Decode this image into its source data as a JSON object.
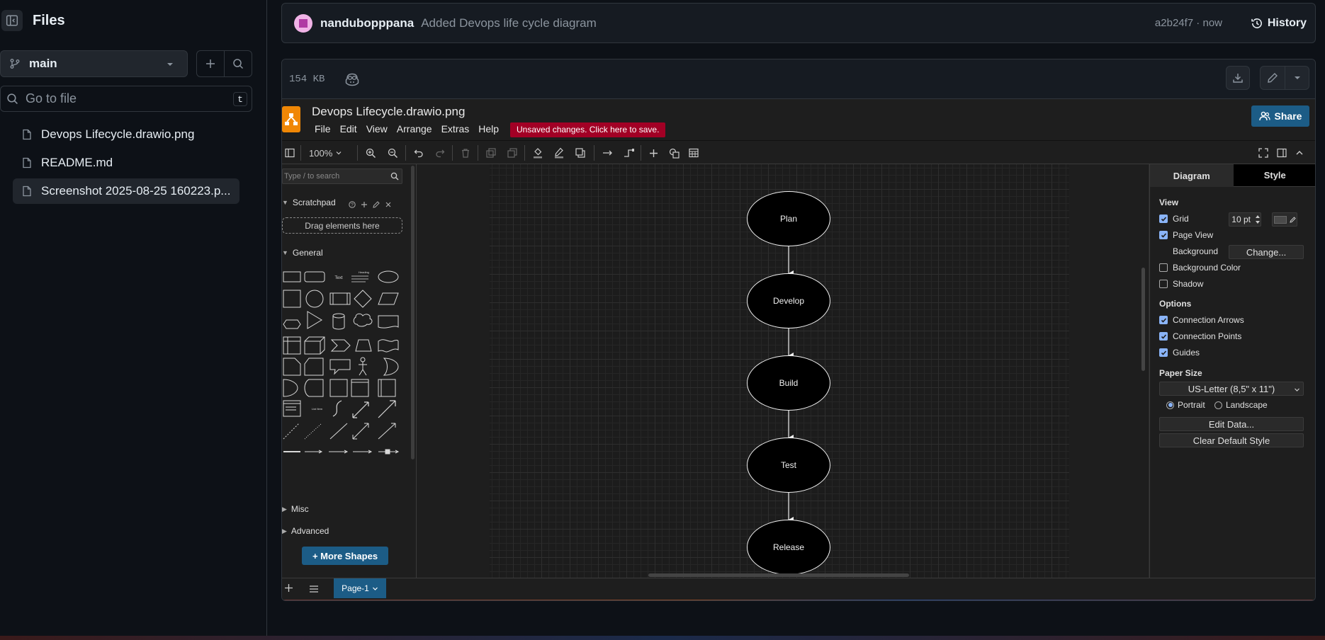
{
  "files_pane": {
    "title": "Files",
    "branch": "main",
    "goto_placeholder": "Go to file",
    "goto_shortcut": "t",
    "files": [
      {
        "name": "Devops Lifecycle.drawio.png",
        "selected": false
      },
      {
        "name": "README.md",
        "selected": false
      },
      {
        "name": "Screenshot 2025-08-25 160223.p...",
        "selected": true
      }
    ]
  },
  "commit": {
    "author": "nandubopppana",
    "message": "Added Devops life cycle diagram",
    "meta": "a2b24f7 · now",
    "history_label": "History"
  },
  "viewer": {
    "file_size": "154  KB"
  },
  "drawio": {
    "title": "Devops Lifecycle.drawio.png",
    "menus": [
      "File",
      "Edit",
      "View",
      "Arrange",
      "Extras",
      "Help"
    ],
    "unsaved_banner": "Unsaved changes. Click here to save.",
    "share_label": "Share",
    "zoom": "100%",
    "search_placeholder": "Type / to search",
    "sections": {
      "scratchpad": "Scratchpad",
      "drag_here": "Drag elements here",
      "general": "General",
      "misc": "Misc",
      "advanced": "Advanced",
      "more_shapes": "+ More Shapes"
    },
    "diagram_nodes": [
      "Plan",
      "Develop",
      "Build",
      "Test",
      "Release"
    ],
    "format_panel": {
      "tabs": [
        "Diagram",
        "Style"
      ],
      "view_heading": "View",
      "grid_label": "Grid",
      "grid_size": "10 pt",
      "grid_checked": true,
      "page_view_label": "Page View",
      "page_view_checked": true,
      "background_label": "Background",
      "change_label": "Change...",
      "background_color_label": "Background Color",
      "background_color_checked": false,
      "shadow_label": "Shadow",
      "shadow_checked": false,
      "options_heading": "Options",
      "connection_arrows_label": "Connection Arrows",
      "connection_arrows_checked": true,
      "connection_points_label": "Connection Points",
      "connection_points_checked": true,
      "guides_label": "Guides",
      "guides_checked": true,
      "paper_size_heading": "Paper Size",
      "paper_size": "US-Letter (8,5\" x 11\")",
      "portrait_label": "Portrait",
      "landscape_label": "Landscape",
      "orientation": "portrait",
      "edit_data_label": "Edit Data...",
      "clear_default_style_label": "Clear Default Style"
    },
    "page_tab": "Page-1"
  },
  "colors": {
    "bg": "#0d1117",
    "border": "#30363d",
    "drawio_accent": "#1c5c86",
    "unsaved_red": "#a20025",
    "drawio_orange": "#f08705"
  }
}
